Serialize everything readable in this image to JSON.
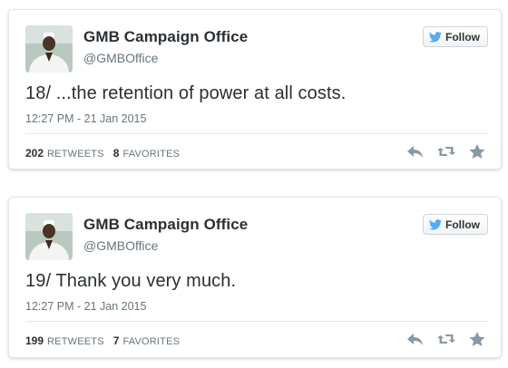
{
  "colors": {
    "text_primary": "#292f33",
    "text_secondary": "#66757f",
    "border": "#e1e8ed",
    "twitter_blue": "#55acee",
    "action_gray": "#8899a6"
  },
  "tweets": [
    {
      "author_name": "GMB Campaign Office",
      "handle": "@GMBOffice",
      "follow_label": "Follow",
      "text": "18/ ...the retention of power at all costs.",
      "timestamp": "12:27 PM - 21 Jan 2015",
      "retweets_count": "202",
      "retweets_label": "RETWEETS",
      "favorites_count": "8",
      "favorites_label": "FAVORITES",
      "icons": [
        "reply-icon",
        "retweet-icon",
        "favorite-star-icon"
      ]
    },
    {
      "author_name": "GMB Campaign Office",
      "handle": "@GMBOffice",
      "follow_label": "Follow",
      "text": "19/ Thank you very much.",
      "timestamp": "12:27 PM - 21 Jan 2015",
      "retweets_count": "199",
      "retweets_label": "RETWEETS",
      "favorites_count": "7",
      "favorites_label": "FAVORITES",
      "icons": [
        "reply-icon",
        "retweet-icon",
        "favorite-star-icon"
      ]
    }
  ]
}
